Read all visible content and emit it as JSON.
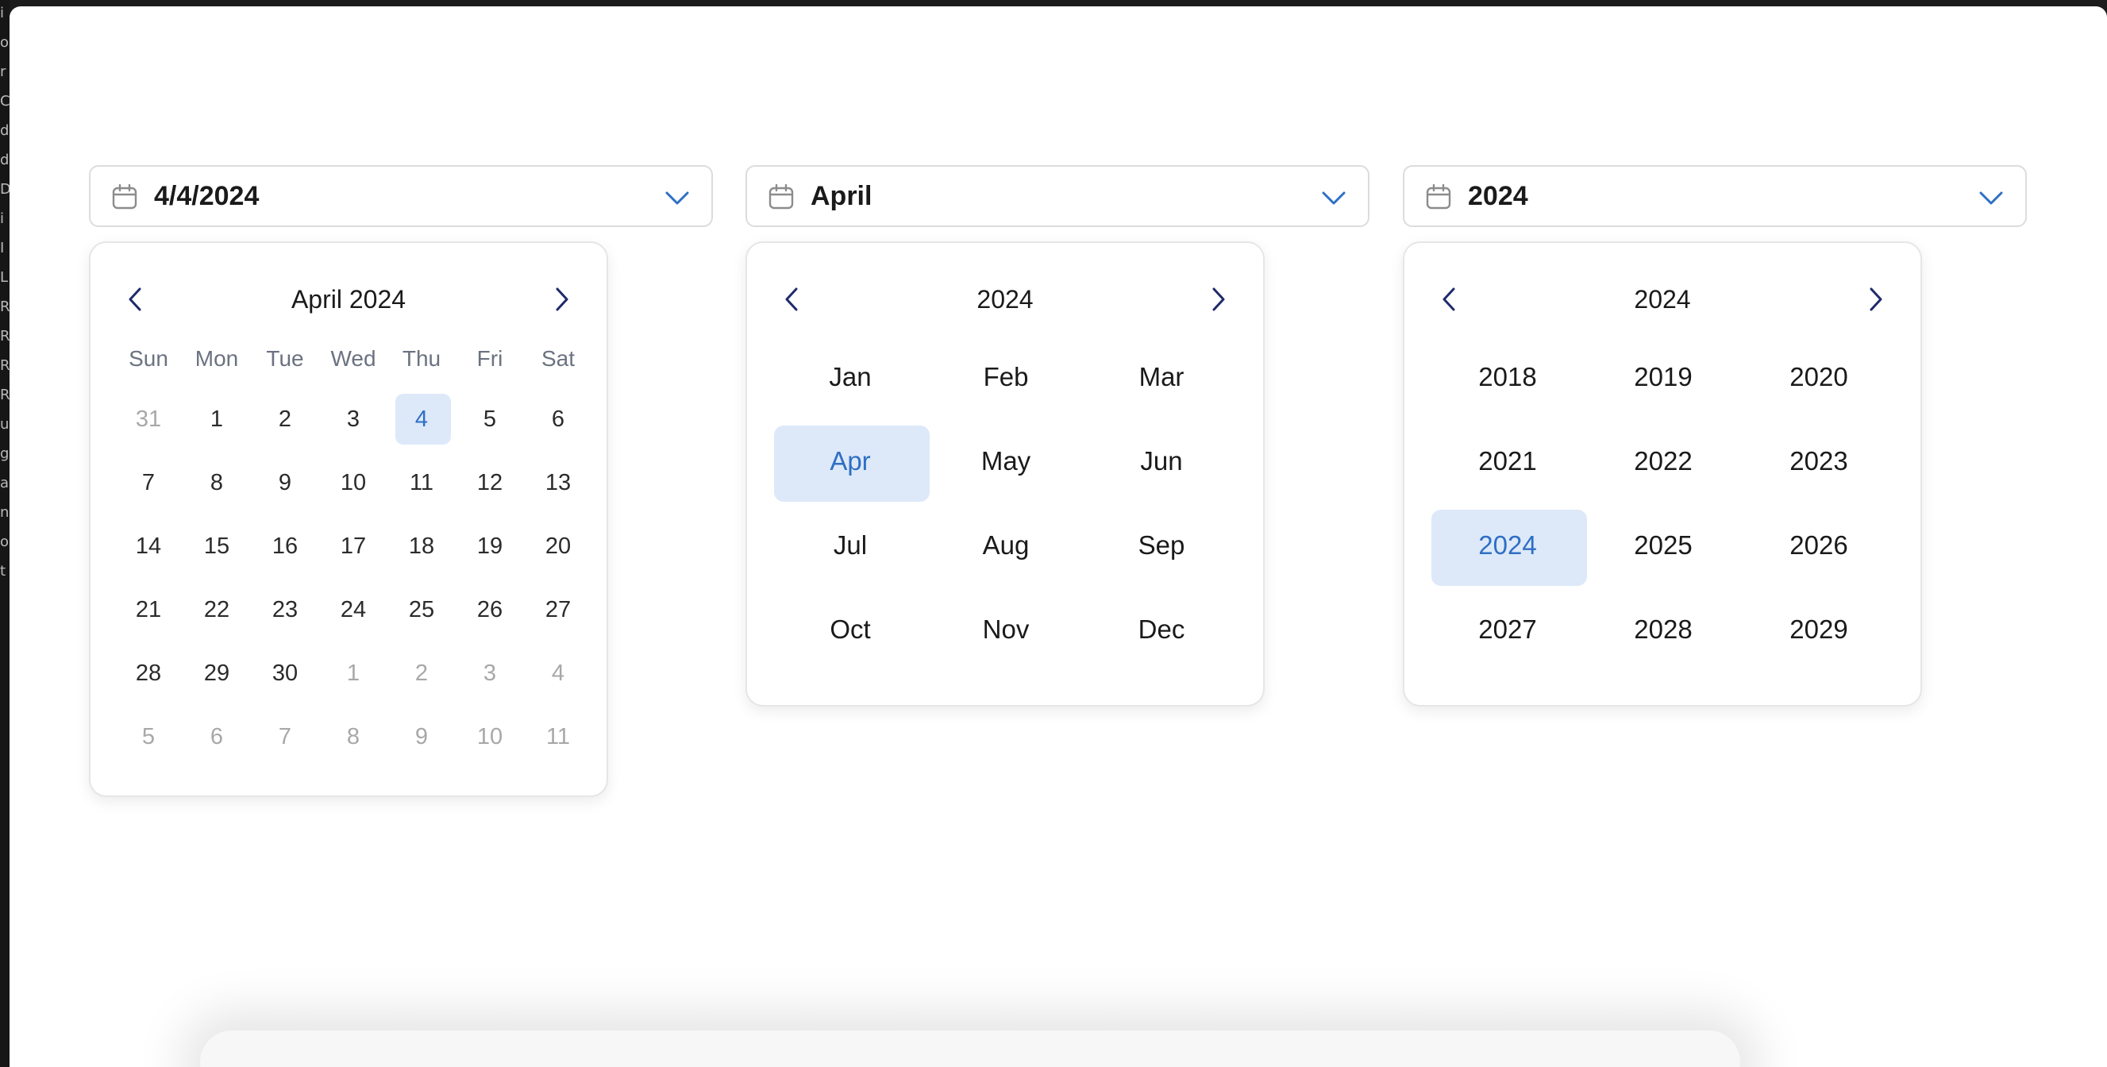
{
  "colors": {
    "accent": "#2f6fc4",
    "selected_bg": "#dde9f9",
    "nav_arrow": "#1f2a6b",
    "muted_text": "#a8a8a8"
  },
  "left_strip_letters": [
    "i",
    "o",
    "r",
    "C",
    "d",
    "d",
    "D",
    "i",
    "I",
    "L",
    "R",
    "R",
    "R",
    "R",
    "u",
    "g",
    "a",
    "n",
    "o",
    "t"
  ],
  "date_picker": {
    "value": "4/4/2024",
    "header": "April 2024",
    "weekdays": [
      "Sun",
      "Mon",
      "Tue",
      "Wed",
      "Thu",
      "Fri",
      "Sat"
    ],
    "days": [
      {
        "label": "31",
        "muted": true
      },
      {
        "label": "1"
      },
      {
        "label": "2"
      },
      {
        "label": "3"
      },
      {
        "label": "4",
        "selected": true
      },
      {
        "label": "5"
      },
      {
        "label": "6"
      },
      {
        "label": "7"
      },
      {
        "label": "8"
      },
      {
        "label": "9"
      },
      {
        "label": "10"
      },
      {
        "label": "11"
      },
      {
        "label": "12"
      },
      {
        "label": "13"
      },
      {
        "label": "14"
      },
      {
        "label": "15"
      },
      {
        "label": "16"
      },
      {
        "label": "17"
      },
      {
        "label": "18"
      },
      {
        "label": "19"
      },
      {
        "label": "20"
      },
      {
        "label": "21"
      },
      {
        "label": "22"
      },
      {
        "label": "23"
      },
      {
        "label": "24"
      },
      {
        "label": "25"
      },
      {
        "label": "26"
      },
      {
        "label": "27"
      },
      {
        "label": "28"
      },
      {
        "label": "29"
      },
      {
        "label": "30"
      },
      {
        "label": "1",
        "muted": true
      },
      {
        "label": "2",
        "muted": true
      },
      {
        "label": "3",
        "muted": true
      },
      {
        "label": "4",
        "muted": true
      },
      {
        "label": "5",
        "muted": true
      },
      {
        "label": "6",
        "muted": true
      },
      {
        "label": "7",
        "muted": true
      },
      {
        "label": "8",
        "muted": true
      },
      {
        "label": "9",
        "muted": true
      },
      {
        "label": "10",
        "muted": true
      },
      {
        "label": "11",
        "muted": true
      }
    ]
  },
  "month_picker": {
    "value": "April",
    "header": "2024",
    "months": [
      {
        "label": "Jan"
      },
      {
        "label": "Feb"
      },
      {
        "label": "Mar"
      },
      {
        "label": "Apr",
        "selected": true
      },
      {
        "label": "May"
      },
      {
        "label": "Jun"
      },
      {
        "label": "Jul"
      },
      {
        "label": "Aug"
      },
      {
        "label": "Sep"
      },
      {
        "label": "Oct"
      },
      {
        "label": "Nov"
      },
      {
        "label": "Dec"
      }
    ]
  },
  "year_picker": {
    "value": "2024",
    "header": "2024",
    "years": [
      {
        "label": "2018"
      },
      {
        "label": "2019"
      },
      {
        "label": "2020"
      },
      {
        "label": "2021"
      },
      {
        "label": "2022"
      },
      {
        "label": "2023"
      },
      {
        "label": "2024",
        "selected": true
      },
      {
        "label": "2025"
      },
      {
        "label": "2026"
      },
      {
        "label": "2027"
      },
      {
        "label": "2028"
      },
      {
        "label": "2029"
      }
    ]
  }
}
